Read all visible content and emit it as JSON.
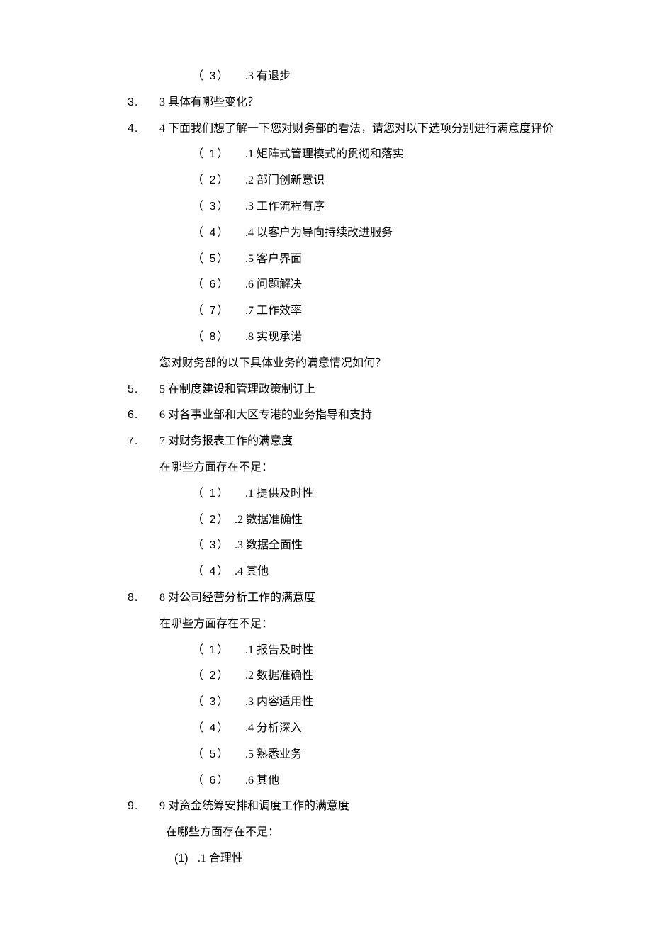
{
  "q2_sub3": {
    "num": "（ 3）",
    "text": ".3 有退步"
  },
  "q3": {
    "num": "3.",
    "text": "3 具体有哪些变化？"
  },
  "q4": {
    "num": "4.",
    "text": "4 下面我们想了解一下您对财务部的看法，请您对以下选项分别进行满意度评价",
    "subs": [
      {
        "num": "（ 1）",
        "text": ".1 矩阵式管理模式的贯彻和落实"
      },
      {
        "num": "（ 2）",
        "text": ".2 部门创新意识"
      },
      {
        "num": "（ 3）",
        "text": ".3 工作流程有序"
      },
      {
        "num": "（ 4）",
        "text": ".4 以客户为导向持续改进服务"
      },
      {
        "num": "（ 5）",
        "text": ".5 客户界面"
      },
      {
        "num": "（ 6）",
        "text": ".6 问题解决"
      },
      {
        "num": "（ 7）",
        "text": ".7 工作效率"
      },
      {
        "num": "（ 8）",
        "text": ".8 实现承诺"
      }
    ],
    "footer": "您对财务部的以下具体业务的满意情况如何？"
  },
  "q5": {
    "num": "5.",
    "text": "5 在制度建设和管理政策制订上"
  },
  "q6": {
    "num": "6.",
    "text": "6 对各事业部和大区专港的业务指导和支持"
  },
  "q7": {
    "num": "7.",
    "text": "7 对财务报表工作的满意度",
    "prompt": "在哪些方面存在不足：",
    "subs": [
      {
        "num": "（ 1）",
        "text": ".1 提供及时性",
        "wide": true
      },
      {
        "num": "（ 2）",
        "text": ".2 数据准确性",
        "wide": false
      },
      {
        "num": "（ 3）",
        "text": ".3 数据全面性",
        "wide": false
      },
      {
        "num": "（ 4）",
        "text": ".4 其他",
        "wide": false
      }
    ]
  },
  "q8": {
    "num": "8.",
    "text": "8 对公司经营分析工作的满意度",
    "prompt": "在哪些方面存在不足：",
    "subs": [
      {
        "num": "（ 1）",
        "text": ".1 报告及时性"
      },
      {
        "num": "（ 2）",
        "text": ".2 数据准确性"
      },
      {
        "num": "（ 3）",
        "text": ".3 内容适用性"
      },
      {
        "num": "（ 4）",
        "text": ".4 分析深入"
      },
      {
        "num": "（ 5）",
        "text": ".5 熟悉业务"
      },
      {
        "num": "（ 6）",
        "text": ".6 其他"
      }
    ]
  },
  "q9": {
    "num": "9.",
    "text": "9 对资金统筹安排和调度工作的满意度",
    "prompt": "在哪些方面存在不足：",
    "sub1": {
      "num": "(1)",
      "text": ".1 合理性"
    }
  }
}
